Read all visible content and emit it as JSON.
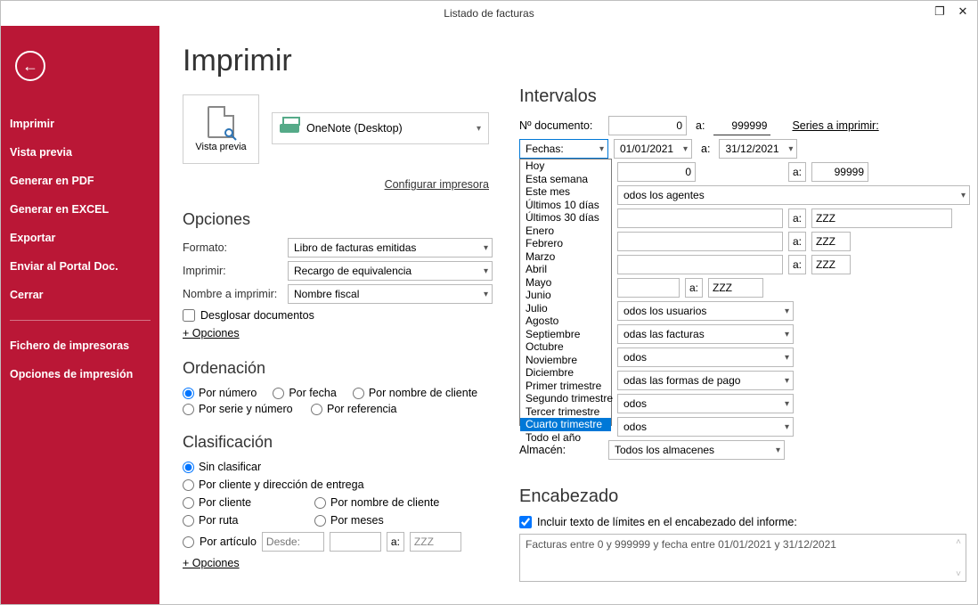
{
  "window": {
    "title": "Listado de facturas"
  },
  "sidebar": {
    "items": [
      "Imprimir",
      "Vista previa",
      "Generar en PDF",
      "Generar en EXCEL",
      "Exportar",
      "Enviar al Portal Doc.",
      "Cerrar"
    ],
    "footer": [
      "Fichero de impresoras",
      "Opciones de impresión"
    ]
  },
  "page": {
    "title": "Imprimir",
    "preview_label": "Vista previa",
    "printer": "OneNote (Desktop)",
    "configure_printer": "Configurar impresora"
  },
  "options": {
    "heading": "Opciones",
    "format_label": "Formato:",
    "format_value": "Libro de facturas emitidas",
    "print_label": "Imprimir:",
    "print_value": "Recargo de equivalencia",
    "name_label": "Nombre a imprimir:",
    "name_value": "Nombre fiscal",
    "breakdown": "Desglosar documentos",
    "more": "+ Opciones"
  },
  "ordering": {
    "heading": "Ordenación",
    "items": [
      "Por número",
      "Por fecha",
      "Por nombre de cliente",
      "Por serie y número",
      "Por referencia"
    ]
  },
  "classification": {
    "heading": "Clasificación",
    "items": [
      "Sin clasificar",
      "Por cliente y dirección de entrega",
      "Por cliente",
      "Por nombre de cliente",
      "Por ruta",
      "Por meses",
      "Por artículo"
    ],
    "desde_label": "Desde:",
    "desde_value": "",
    "a_label": "a:",
    "a_value": "ZZZ",
    "more": "+ Opciones"
  },
  "intervals": {
    "heading": "Intervalos",
    "doc_label": "Nº documento:",
    "doc_from": "0",
    "doc_to": "999999",
    "series_link": "Series a imprimir:",
    "dates_label": "Fechas:",
    "date_from": "01/01/2021",
    "date_to": "31/12/2021",
    "dates_options": [
      "Hoy",
      "Esta semana",
      "Este mes",
      "Últimos 10 días",
      "Últimos 30 días",
      "Enero",
      "Febrero",
      "Marzo",
      "Abril",
      "Mayo",
      "Junio",
      "Julio",
      "Agosto",
      "Septiembre",
      "Octubre",
      "Noviembre",
      "Diciembre",
      "Primer trimestre",
      "Segundo trimestre",
      "Tercer trimestre",
      "Cuarto trimestre",
      "Todo el año"
    ],
    "dates_selected_index": 20,
    "row3_from": "0",
    "row3_to": "99999",
    "row4_value": "odos los agentes",
    "row5_from": "",
    "row5_to": "ZZZ",
    "row6_from": "",
    "row6_to": "ZZZ",
    "row7_from": "",
    "row7_to": "ZZZ",
    "row8_from": "",
    "row8_a_label": "a:",
    "row8_to": "ZZZ",
    "combo_users": "odos los usuarios",
    "combo_invoices": "odas las facturas",
    "combo_r1": "odos",
    "combo_payments": "odas las formas de pago",
    "combo_r2": "odos",
    "combo_r3": "odos",
    "warehouse_label": "Almacén:",
    "warehouse_value": "Todos los almacenes",
    "a": "a:"
  },
  "header": {
    "heading": "Encabezado",
    "checkbox": "Incluir texto de límites en el encabezado del informe:",
    "text": "Facturas entre 0 y 999999 y fecha entre 01/01/2021 y 31/12/2021"
  }
}
